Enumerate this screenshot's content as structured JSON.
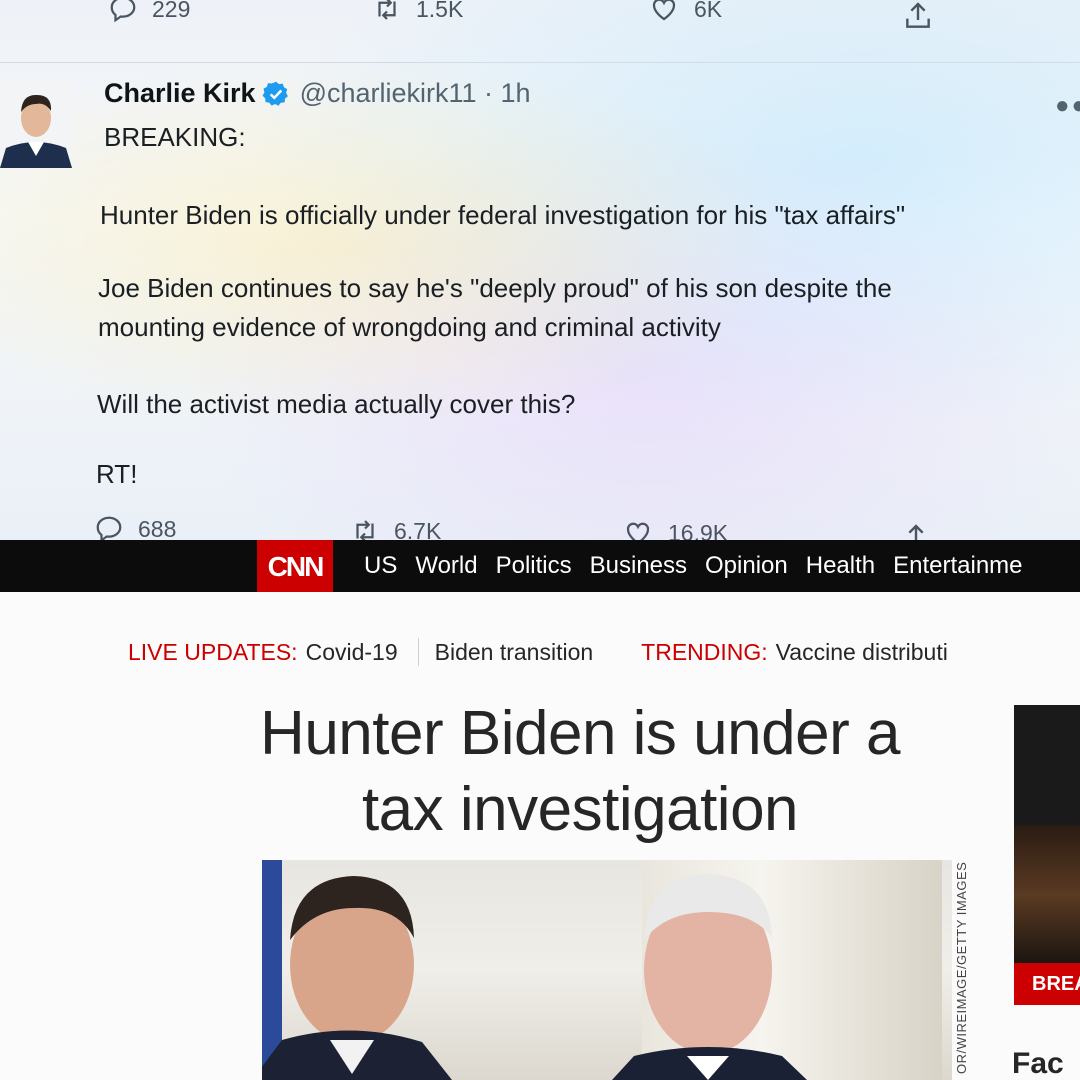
{
  "prev_tweet_actions": {
    "replies": "229",
    "retweets": "1.5K",
    "likes": "6K"
  },
  "tweet": {
    "author_name": "Charlie Kirk",
    "handle_time": "@charliekirk11 · 1h",
    "lines": [
      "BREAKING:",
      "Hunter Biden is officially under federal investigation for his \"tax affairs\"",
      "Joe Biden continues to say he's \"deeply proud\" of his son despite the",
      "mounting evidence of wrongdoing and criminal activity",
      "Will the activist media actually cover this?",
      "RT!"
    ],
    "actions": {
      "replies": "688",
      "retweets": "6.7K",
      "likes": "16.9K"
    }
  },
  "cnn": {
    "logo": "CNN",
    "nav": [
      "US",
      "World",
      "Politics",
      "Business",
      "Opinion",
      "Health",
      "Entertainme"
    ],
    "ticker": {
      "live_label": "LIVE UPDATES:",
      "live_item": "Covid-19",
      "item2": "Biden transition",
      "trending_label": "TRENDING:",
      "trending_item": "Vaccine distributi"
    },
    "headline_line1": "Hunter Biden is under a",
    "headline_line2": "tax investigation",
    "photo_credit": "OR/WIREIMAGE/GETTY IMAGES",
    "side_badge": "BREA",
    "side_text": "Fac"
  },
  "colors": {
    "cnn_red": "#cc0000",
    "twitter_blue": "#1d9bf0"
  }
}
